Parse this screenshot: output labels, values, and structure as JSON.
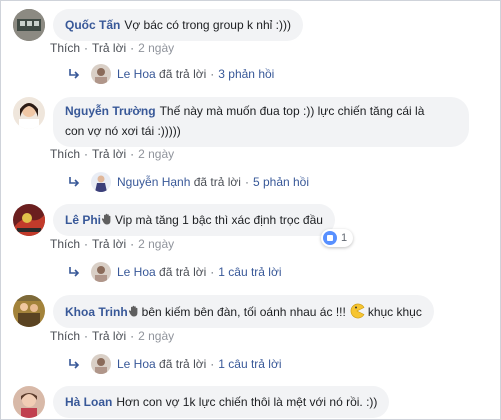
{
  "colors": {
    "link": "#385898",
    "bubble": "#f2f3f5",
    "meta": "#606770",
    "like": "#5890ff"
  },
  "comments": [
    {
      "author": "Quốc Tấn",
      "text": "Vợ bác có trong group k nhỉ :)))",
      "actions": {
        "like": "Thích",
        "reply": "Trả lời",
        "time": "2 ngày"
      },
      "reply_summary": {
        "name": "Le Hoa",
        "verb": "đã trả lời",
        "count": "3 phản hồi"
      }
    },
    {
      "author": "Nguyễn Trường",
      "text_line1": "Thế này mà muốn đua top :)) lực chiến tăng cái là",
      "text_line2": "con vợ nó xơi tái :)))))",
      "actions": {
        "like": "Thích",
        "reply": "Trả lời",
        "time": "2 ngày"
      },
      "reply_summary": {
        "name": "Nguyễn Hạnh",
        "verb": "đã trả lời",
        "count": "5 phản hồi"
      }
    },
    {
      "author": "Lê Phi",
      "badge_icon": "raised-hand-icon",
      "text": "Vip mà tăng 1 bậc thì xác định trọc đầu",
      "reaction": {
        "icon": "like-icon",
        "count": "1"
      },
      "actions": {
        "like": "Thích",
        "reply": "Trả lời",
        "time": "2 ngày"
      },
      "reply_summary": {
        "name": "Le Hoa",
        "verb": "đã trả lời",
        "count": "1 câu trả lời"
      }
    },
    {
      "author": "Khoa Trinh",
      "badge_icon": "raised-hand-icon",
      "text_before": "bên kiếm bên đàn, tối oánh nhau ác !!!",
      "emoji": "pacman-emoji-icon",
      "text_after": "khục khục",
      "actions": {
        "like": "Thích",
        "reply": "Trả lời",
        "time": "2 ngày"
      },
      "reply_summary": {
        "name": "Le Hoa",
        "verb": "đã trả lời",
        "count": "1 câu trả lời"
      }
    },
    {
      "author": "Hà Loan",
      "text": "Hơn con vợ 1k lực chiến thôi là mệt với nó rồi. :))"
    }
  ]
}
